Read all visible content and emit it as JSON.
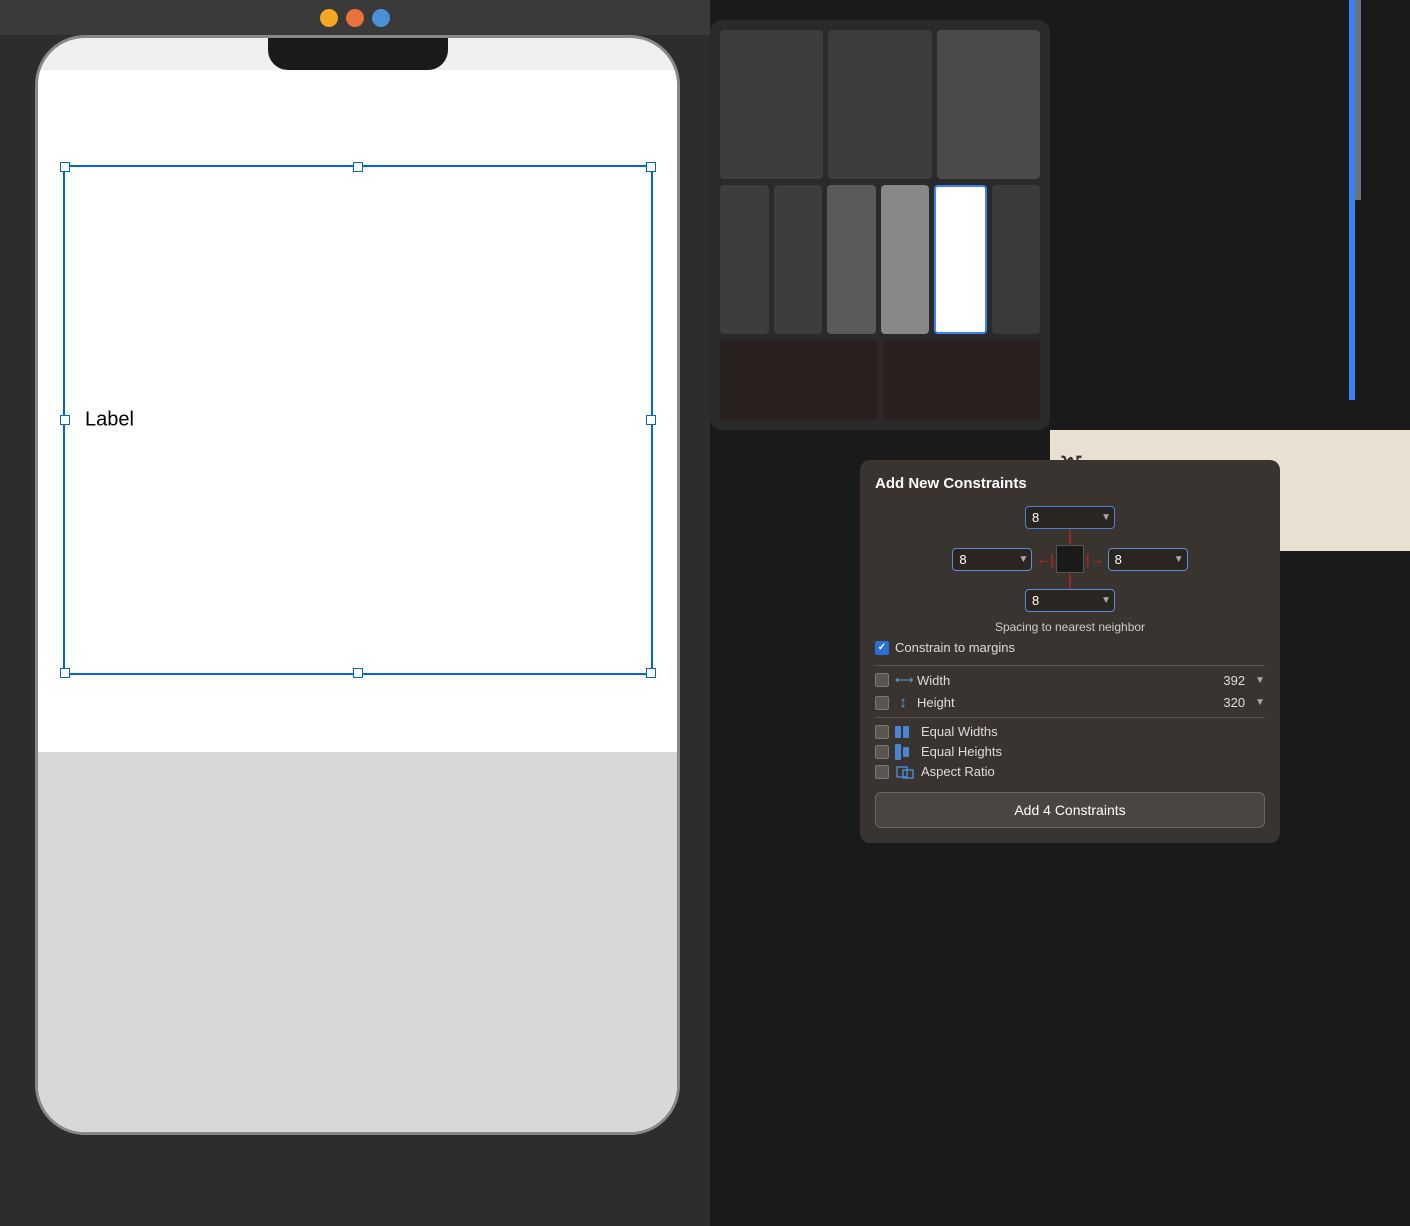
{
  "toolbar": {
    "dots": [
      "yellow",
      "orange",
      "blue"
    ]
  },
  "iphone": {
    "label": "Label"
  },
  "appSwitcher": {
    "visible": true
  },
  "constraintsPanel": {
    "title": "Add New Constraints",
    "spacingTop": "8",
    "spacingLeft": "8",
    "spacingRight": "8",
    "spacingBottom": "8",
    "constrainToMargins": "Constrain to margins",
    "widthLabel": "Width",
    "widthValue": "392",
    "heightLabel": "Height",
    "heightValue": "320",
    "equalWidthsLabel": "Equal Widths",
    "equalHeightsLabel": "Equal Heights",
    "aspectRatioLabel": "Aspect Ratio",
    "spacingLabel": "Spacing to nearest neighbor",
    "addButtonLabel": "Add 4 Constraints"
  }
}
